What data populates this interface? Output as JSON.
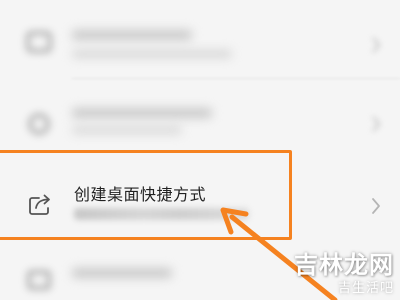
{
  "list": {
    "shortcut_item": {
      "title": "创建桌面快捷方式",
      "icon": "share-arrow-icon"
    }
  },
  "annotation": {
    "highlight_color": "#f58220",
    "arrow_color": "#f58220"
  },
  "watermark": {
    "main": "吉林龙网",
    "sub": "吉生活吧"
  }
}
